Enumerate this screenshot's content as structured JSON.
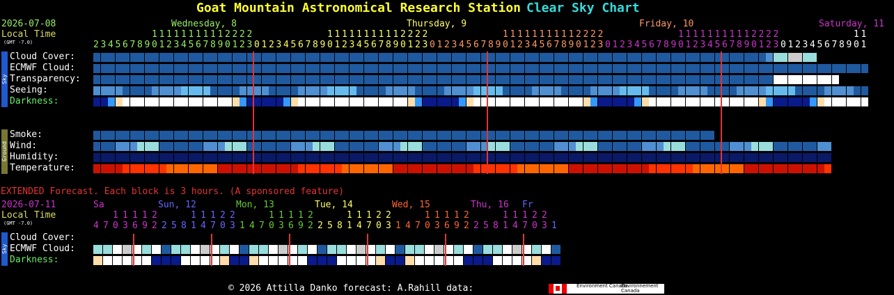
{
  "header": {
    "title": "Goat Mountain Astronomical Research Station",
    "subtitle": "Clear Sky Chart"
  },
  "main": {
    "date": "2026-07-08",
    "local_time": "Local Time",
    "gmt": "(GMT -7.0)",
    "days": [
      {
        "label": "Wednesday, 8",
        "color": "#99ee66"
      },
      {
        "label": "Thursday, 9",
        "color": "#ffff66"
      },
      {
        "label": "Friday, 10",
        "color": "#ff9966"
      },
      {
        "label": "Saturday, 11",
        "color": "#cc33cc"
      }
    ],
    "hours": [
      "2",
      "3",
      "4",
      "5",
      "6",
      "7",
      "8",
      "9",
      "10",
      "11",
      "12",
      "13",
      "14",
      "15",
      "16",
      "17",
      "18",
      "19",
      "20",
      "21",
      "22",
      "23",
      "0",
      "1",
      "2",
      "3",
      "4",
      "5",
      "6",
      "7",
      "8",
      "9",
      "10",
      "11",
      "12",
      "13",
      "14",
      "15",
      "16",
      "17",
      "18",
      "19",
      "20",
      "21",
      "22",
      "23",
      "0",
      "1",
      "2",
      "3",
      "4",
      "5",
      "6",
      "7",
      "8",
      "9",
      "10",
      "11",
      "12",
      "13",
      "14",
      "15",
      "16",
      "17",
      "18",
      "19",
      "20",
      "21",
      "22",
      "23",
      "0",
      "1",
      "2",
      "3",
      "4",
      "5",
      "6",
      "7",
      "8",
      "9",
      "10",
      "11",
      "12",
      "13",
      "14",
      "15",
      "16",
      "17",
      "18",
      "19",
      "20",
      "21",
      "22",
      "23",
      "0",
      "1",
      "2",
      "3",
      "4",
      "5",
      "6",
      "7",
      "8",
      "9",
      "10",
      "11"
    ],
    "sky_rows": [
      "Cloud Cover:",
      "ECMWF Cloud:",
      "Transparency:",
      "Seeing:",
      "Darkness:"
    ],
    "ground_rows": [
      "Smoke:",
      "Wind:",
      "Humidity:",
      "Temperature:"
    ],
    "sky_tab": "Sky",
    "ground_tab": "Ground"
  },
  "extended": {
    "heading": "EXTENDED Forecast. Each block is 3 hours. (A sponsored feature)",
    "date": "2026-07-11",
    "local_time": "Local Time",
    "gmt": "(GMT -7.0)",
    "days": [
      {
        "label": "Sa",
        "color": "#cc33cc"
      },
      {
        "label": "Sun, 12",
        "color": "#6666ff"
      },
      {
        "label": "Mon, 13",
        "color": "#66cc33"
      },
      {
        "label": "Tue, 14",
        "color": "#ffff66"
      },
      {
        "label": "Wed, 15",
        "color": "#ff6633"
      },
      {
        "label": "Thu, 16",
        "color": "#cc33cc"
      },
      {
        "label": "Fr",
        "color": "#6666ff"
      }
    ],
    "hours": [
      "4",
      "7",
      "10",
      "13",
      "16",
      "19",
      "22",
      "2",
      "5",
      "8",
      "11",
      "14",
      "17",
      "20",
      "23",
      "1",
      "4",
      "7",
      "10",
      "13",
      "16",
      "19",
      "22",
      "2",
      "5",
      "8",
      "11",
      "14",
      "17",
      "20",
      "23",
      "1",
      "4",
      "7",
      "10",
      "13",
      "16",
      "19",
      "22",
      "2",
      "5",
      "8",
      "11",
      "14",
      "17",
      "20",
      "23",
      "1"
    ],
    "sky_rows": [
      "Cloud Cover:",
      "ECMWF Cloud:",
      "Darkness:"
    ],
    "sky_tab": "Sky"
  },
  "footer": {
    "text": "© 2026 Attilla Danko  forecast: A.Rahill  data:",
    "env1": "Environment Canada",
    "env2": "Environnement Canada"
  },
  "colors": {
    "dark_blue": "#0d3f7a",
    "mid_blue": "#1f5aa0",
    "light_blue": "#4f8fd2",
    "sky": "#66bbee",
    "cyan": "#99dddd",
    "white": "#ffffff",
    "grey": "#cccccc",
    "red_line": "#e53333",
    "dark_label": "#66ee66"
  }
}
